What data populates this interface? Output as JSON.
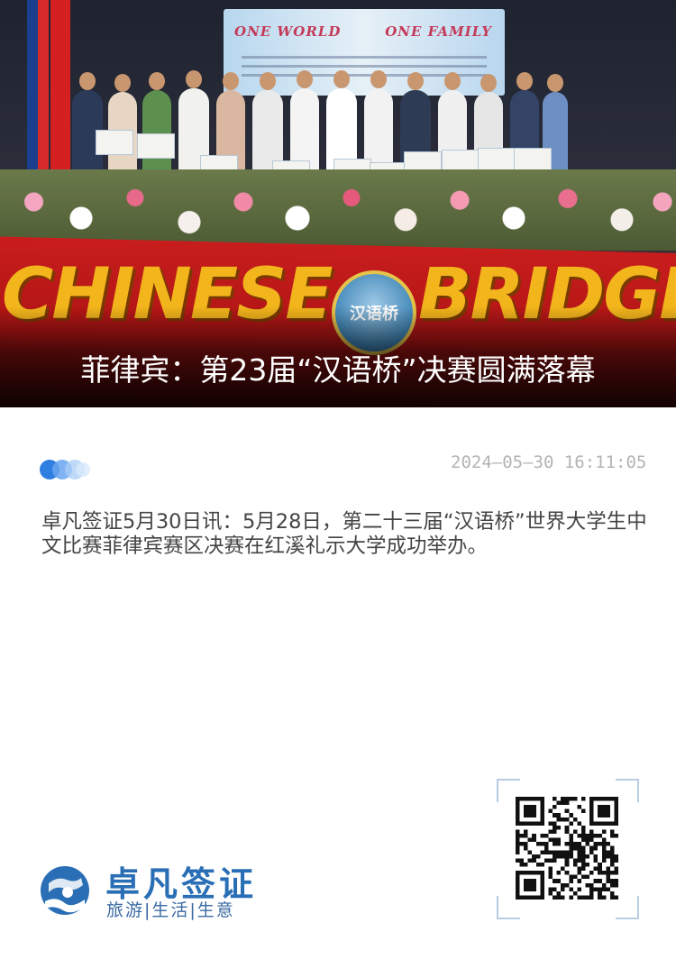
{
  "article": {
    "title": "菲律宾：第23届“汉语桥”决赛圆满落幕",
    "datetime": "2024—05—30 16:11:05",
    "body": "卓凡签证5月30日讯：5月28日，第二十三届“汉语桥”世界大学生中文比赛菲律宾赛区决赛在红溪礼示大学成功举办。"
  },
  "photo": {
    "banner_left": "CHINESE",
    "banner_right": "BRIDGE",
    "banner_logo_text": "汉语桥",
    "screen_left": "ONE WORLD",
    "screen_right": "ONE FAMILY"
  },
  "brand": {
    "name": "卓凡签证",
    "tagline": "旅游|生活|生意",
    "logo_icon": "globe-hands-icon"
  },
  "qr": {
    "icon": "qr-code-icon"
  },
  "colors": {
    "brand_blue": "#2a6fb6",
    "banner_red": "#c81d1d",
    "banner_gold": "#f3b51c",
    "date_gray": "#b3b3b3",
    "body_text": "#444444"
  }
}
